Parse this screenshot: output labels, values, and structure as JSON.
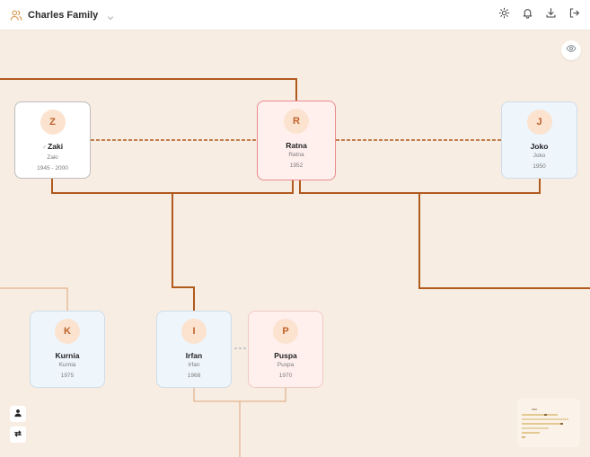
{
  "header": {
    "title": "Charles Family",
    "icons": {
      "brand": "users-icon",
      "menu": "chevron-down-icon",
      "theme": "sun-icon",
      "notifications": "bell-icon",
      "export": "download-icon",
      "logout": "logout-icon"
    }
  },
  "people": {
    "zaki": {
      "initial": "Z",
      "mark": "♂",
      "name": "Zaki",
      "sub": "Zaki",
      "years": "1945 - 2000"
    },
    "ratna": {
      "initial": "R",
      "name": "Ratna",
      "sub": "Ratna",
      "years": "1952"
    },
    "joko": {
      "initial": "J",
      "name": "Joko",
      "sub": "Joko",
      "years": "1950"
    },
    "kurnia": {
      "initial": "K",
      "name": "Kurnia",
      "sub": "Kurnia",
      "years": "1975"
    },
    "irfan": {
      "initial": "I",
      "name": "Irfan",
      "sub": "Irfan",
      "years": "1968"
    },
    "puspa": {
      "initial": "P",
      "name": "Puspa",
      "sub": "Puspa",
      "years": "1970"
    }
  },
  "controls": {
    "visibility": "eye-icon",
    "person": "person-icon",
    "swap": "swap-icon"
  },
  "colors": {
    "canvas": "#f8ede2",
    "connector": "#b05a1e",
    "connector_light": "#dca57a",
    "avatar_bg": "#fbe3cf",
    "avatar_text": "#c0622c",
    "selected_border": "#e88a8f"
  }
}
